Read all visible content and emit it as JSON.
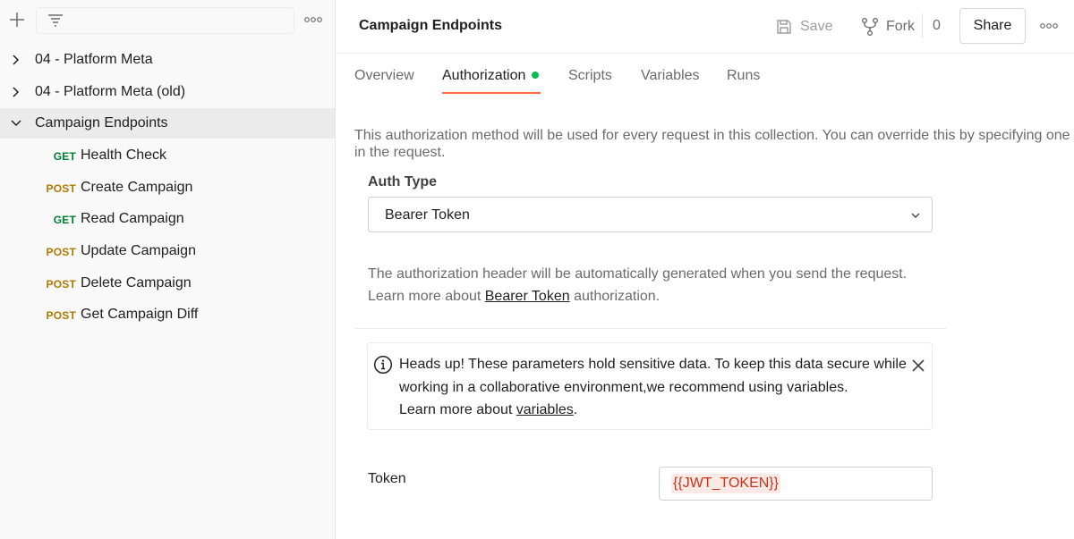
{
  "sidebar": {
    "tree": [
      {
        "label": "04 - Platform Meta",
        "expanded": false
      },
      {
        "label": "04 - Platform Meta (old)",
        "expanded": false
      },
      {
        "label": "Campaign Endpoints",
        "expanded": true,
        "selected": true
      }
    ],
    "requests": [
      {
        "method": "GET",
        "label": "Health Check"
      },
      {
        "method": "POST",
        "label": "Create Campaign"
      },
      {
        "method": "GET",
        "label": "Read Campaign"
      },
      {
        "method": "POST",
        "label": "Update Campaign"
      },
      {
        "method": "POST",
        "label": "Delete Campaign"
      },
      {
        "method": "POST",
        "label": "Get Campaign Diff"
      }
    ]
  },
  "header": {
    "title": "Campaign Endpoints",
    "save_label": "Save",
    "fork_label": "Fork",
    "fork_count": "0",
    "share_label": "Share"
  },
  "tabs": [
    {
      "label": "Overview",
      "active": false
    },
    {
      "label": "Authorization",
      "active": true,
      "indicator": true
    },
    {
      "label": "Scripts",
      "active": false
    },
    {
      "label": "Variables",
      "active": false
    },
    {
      "label": "Runs",
      "active": false
    }
  ],
  "content": {
    "description": "This authorization method will be used for every request in this collection. You can override this by specifying one in the request.",
    "auth_type_label": "Auth Type",
    "auth_type_value": "Bearer Token",
    "info_line1": "The authorization header will be automatically generated when you send the request.",
    "info_line2_prefix": "Learn more about ",
    "info_line2_link": "Bearer Token",
    "info_line2_suffix": " authorization.",
    "alert": {
      "text": "Heads up! These parameters hold sensitive data. To keep this data secure while working in a collaborative environment,we recommend using variables.",
      "learn_prefix": "Learn more about ",
      "learn_link": "variables",
      "learn_suffix": "."
    },
    "token_label": "Token",
    "token_value": "{{JWT_TOKEN}}"
  },
  "colors": {
    "accent": "#ff6c37",
    "get": "#007f31",
    "post": "#ad7a03",
    "status_dot": "#0cbb52",
    "variable_text": "#c8331a"
  }
}
